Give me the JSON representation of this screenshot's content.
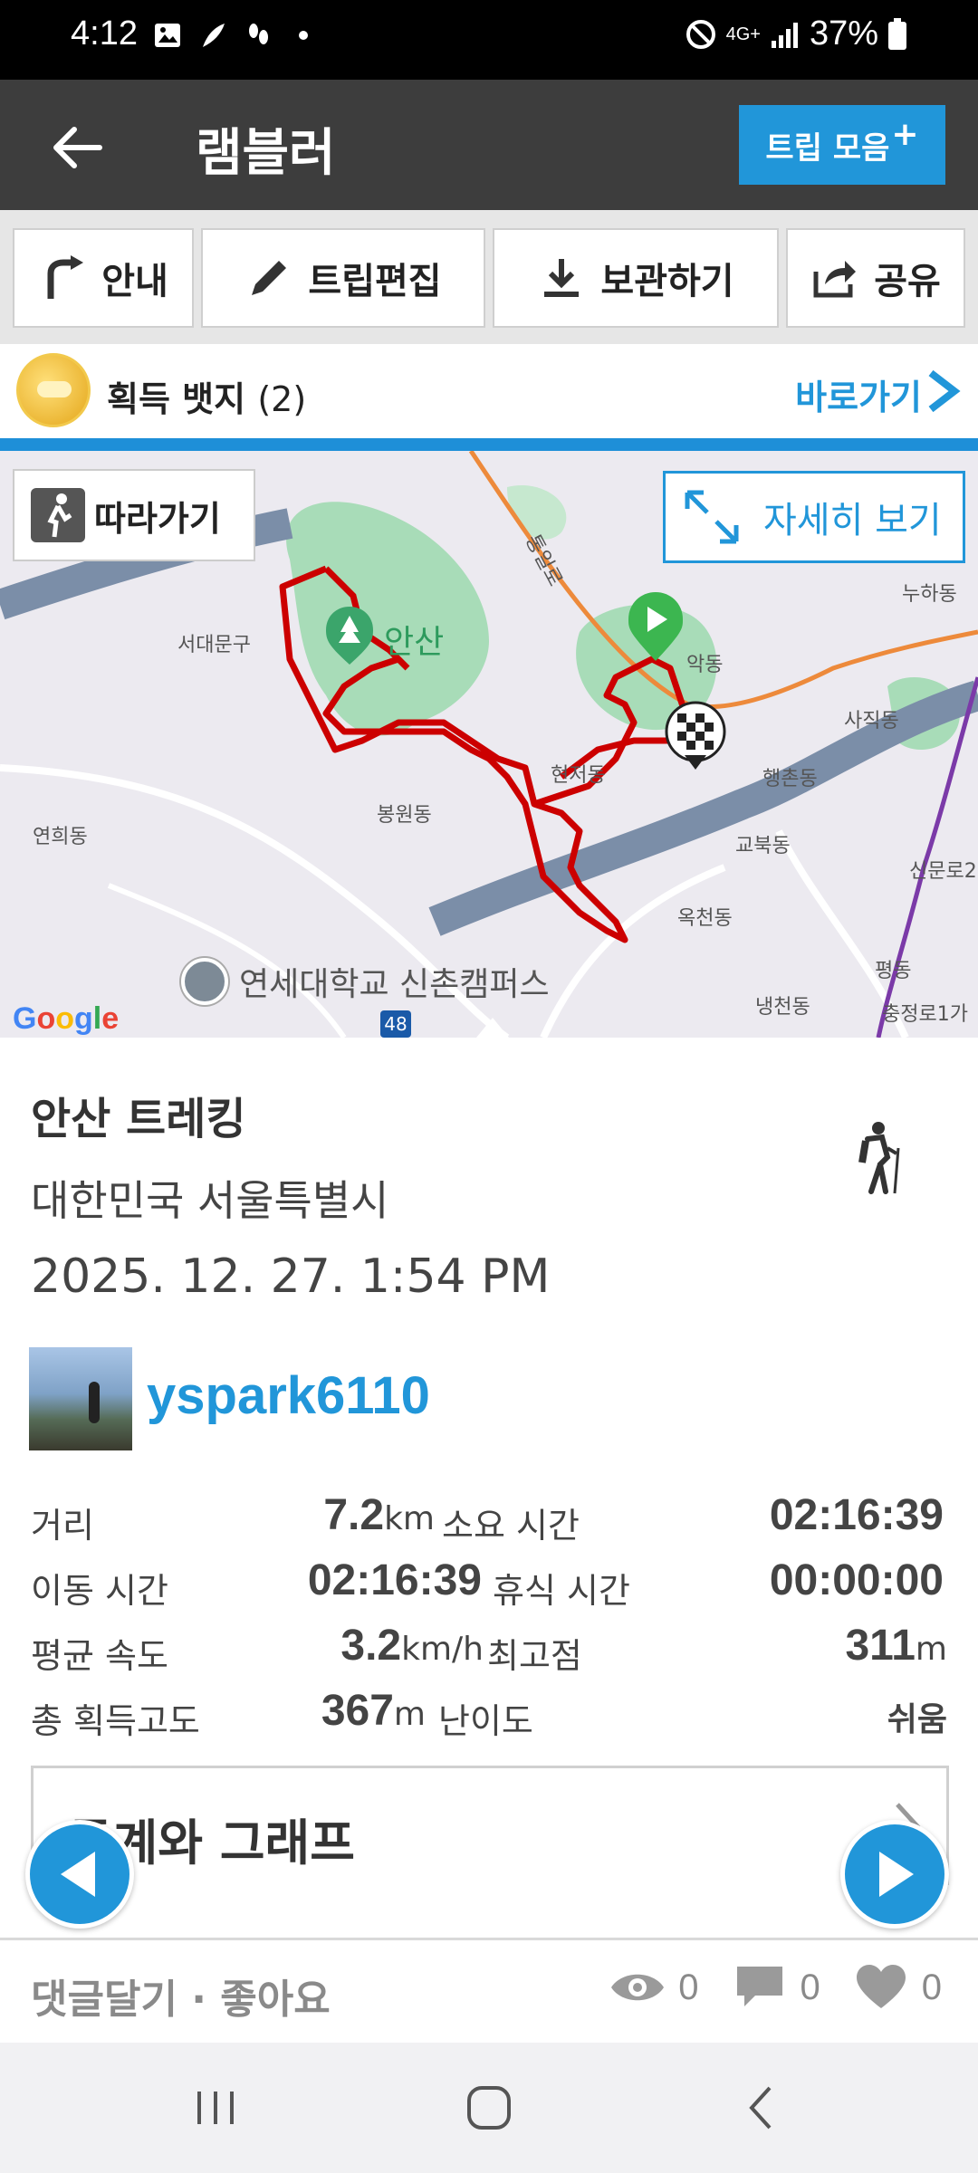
{
  "status_bar": {
    "time": "4:12",
    "network": "4G+",
    "battery": "37%"
  },
  "app_bar": {
    "title": "램블러",
    "trip_button": "트립 모음",
    "trip_button_plus": "+"
  },
  "toolbar": {
    "guide": "안내",
    "edit": "트립편집",
    "save": "보관하기",
    "share": "공유"
  },
  "badge": {
    "label": "획득 뱃지",
    "count": "(2)",
    "goto": "바로가기"
  },
  "map": {
    "follow": "따라가기",
    "detail": "자세히 보기",
    "provider": "Google",
    "campus": "연세대학교 신촌캠퍼스",
    "route_shield": "48",
    "labels": {
      "ansan": "안산",
      "seodaemun": "서대문구",
      "bongwon": "봉원동",
      "yeonhui": "연희동",
      "hyeonjeo": "현저동",
      "haengchon": "행촌동",
      "gyobuk": "교북동",
      "okcheon": "옥천동",
      "sajik": "사직동",
      "nuha": "누하동",
      "sinmunro": "신문로2",
      "pyeong": "평동",
      "naengcheon": "냉천동",
      "chungjeongro": "충정로1가",
      "tongil": "통일로",
      "akdong": "악동"
    }
  },
  "trip": {
    "title": "안산 트레킹",
    "location": "대한민국 서울특별시",
    "date": "2025. 12. 27. 1:54 PM",
    "user": "yspark6110"
  },
  "stats": {
    "distance_label": "거리",
    "distance_value": "7.2",
    "distance_unit": "km",
    "duration_label": "소요 시간",
    "duration_value": "02:16:39",
    "moving_label": "이동 시간",
    "moving_value": "02:16:39",
    "rest_label": "휴식 시간",
    "rest_value": "00:00:00",
    "avg_speed_label": "평균 속도",
    "avg_speed_value": "3.2",
    "avg_speed_unit": "km/h",
    "max_alt_label": "최고점",
    "max_alt_value": "311",
    "max_alt_unit": "m",
    "gain_label": "총 획득고도",
    "gain_value": "367",
    "gain_unit": "m",
    "difficulty_label": "난이도",
    "difficulty_value": "쉬움"
  },
  "stats_graph": {
    "title": "통계와 그래프"
  },
  "footer": {
    "comments": "댓글달기 · 좋아요",
    "views": "0",
    "comment_count": "0",
    "likes": "0"
  },
  "colors": {
    "accent": "#2196d9",
    "route": "#cc0000",
    "appbar": "#3d3d3d"
  }
}
